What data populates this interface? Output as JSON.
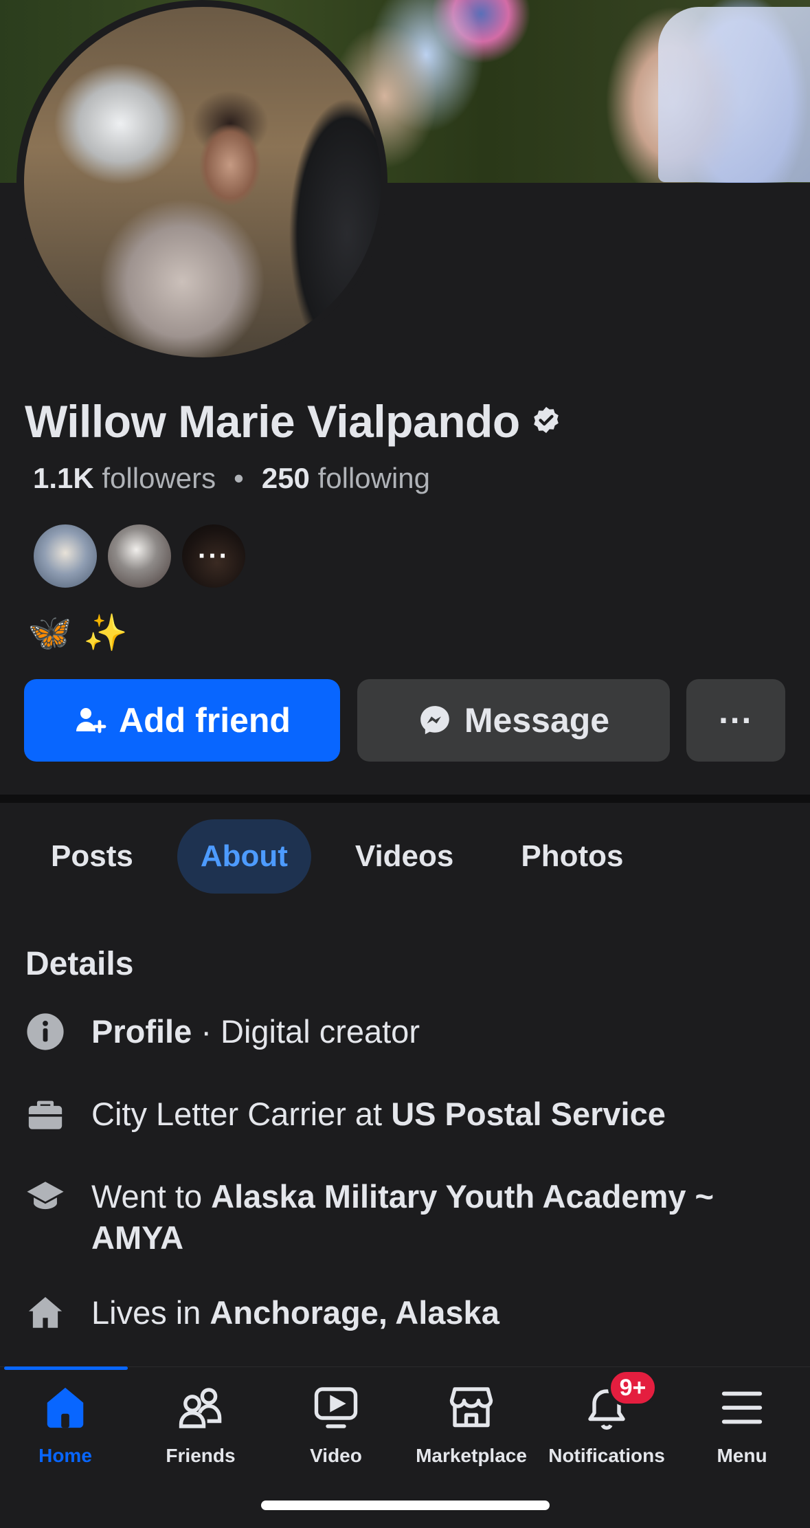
{
  "profile": {
    "name": "Willow Marie Vialpando",
    "followers_count": "1.1K",
    "followers_label": "followers",
    "separator": "•",
    "following_count": "250",
    "following_label": "following",
    "bio": "🦋 ✨",
    "mutual_more": "···"
  },
  "actions": {
    "add_friend": "Add friend",
    "message": "Message",
    "more": "···"
  },
  "tabs": [
    {
      "label": "Posts",
      "active": false
    },
    {
      "label": "About",
      "active": true
    },
    {
      "label": "Videos",
      "active": false
    },
    {
      "label": "Photos",
      "active": false
    }
  ],
  "details": {
    "title": "Details",
    "profile_label": "Profile",
    "profile_value": " · Digital creator",
    "work_prefix": "City Letter Carrier at ",
    "work_place": "US Postal Service",
    "edu_prefix": "Went to ",
    "edu_place": "Alaska Military Youth Academy ~ AMYA",
    "lives_prefix": "Lives in ",
    "lives_place": "Anchorage, Alaska"
  },
  "nav": {
    "home": "Home",
    "friends": "Friends",
    "video": "Video",
    "marketplace": "Marketplace",
    "notifications": "Notifications",
    "notifications_badge": "9+",
    "menu": "Menu"
  },
  "colors": {
    "background": "#1c1c1e",
    "accent": "#0866ff",
    "badge": "#e41e3f",
    "tab_active_bg": "#1e3250"
  }
}
